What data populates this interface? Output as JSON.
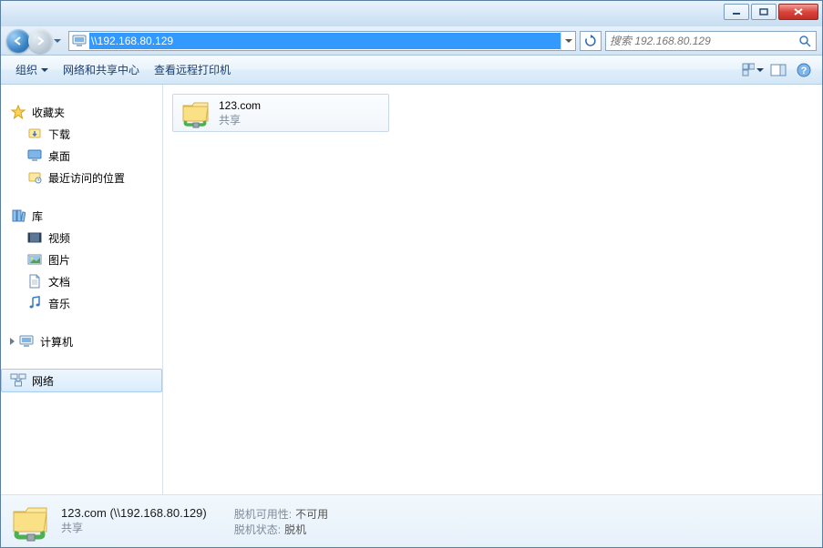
{
  "address": {
    "value": "\\\\192.168.80.129"
  },
  "search": {
    "placeholder": "搜索 192.168.80.129"
  },
  "toolbar": {
    "organize": "组织",
    "network_center": "网络和共享中心",
    "view_printers": "查看远程打印机"
  },
  "sidebar": {
    "favorites": {
      "label": "收藏夹",
      "items": [
        {
          "label": "下载"
        },
        {
          "label": "桌面"
        },
        {
          "label": "最近访问的位置"
        }
      ]
    },
    "libraries": {
      "label": "库",
      "items": [
        {
          "label": "视频"
        },
        {
          "label": "图片"
        },
        {
          "label": "文档"
        },
        {
          "label": "音乐"
        }
      ]
    },
    "computer": {
      "label": "计算机"
    },
    "network": {
      "label": "网络"
    }
  },
  "content": {
    "items": [
      {
        "name": "123.com",
        "sub": "共享"
      }
    ]
  },
  "details": {
    "title": "123.com (\\\\192.168.80.129)",
    "sub": "共享",
    "offline_avail_label": "脱机可用性:",
    "offline_avail_value": "不可用",
    "offline_status_label": "脱机状态:",
    "offline_status_value": "脱机"
  }
}
